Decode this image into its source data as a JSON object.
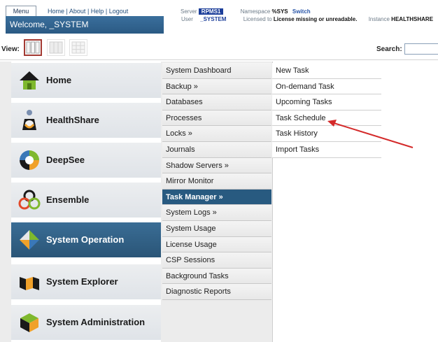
{
  "header": {
    "menu_tab": "Menu",
    "links": [
      "Home",
      "About",
      "Help",
      "Logout"
    ],
    "link_separator": "|",
    "welcome": "Welcome, _SYSTEM",
    "server_label": "Server",
    "server_value": "RPMS1",
    "user_label": "User",
    "user_value": "_SYSTEM",
    "namespace_label": "Namespace",
    "namespace_value": "%SYS",
    "switch_label": "Switch",
    "licensed_label": "Licensed to",
    "licensed_value": "License missing or unreadable.",
    "instance_label": "Instance",
    "instance_value": "HEALTHSHARE"
  },
  "viewbar": {
    "view_label": "View:",
    "search_label": "Search:",
    "search_value": ""
  },
  "categories": [
    {
      "label": "Home",
      "icon": "home-icon",
      "active": false
    },
    {
      "label": "HealthShare",
      "icon": "healthshare-icon",
      "active": false
    },
    {
      "label": "DeepSee",
      "icon": "deepsee-icon",
      "active": false
    },
    {
      "label": "Ensemble",
      "icon": "ensemble-icon",
      "active": false
    },
    {
      "label": "System Operation",
      "icon": "system-operation-icon",
      "active": true
    },
    {
      "label": "System Explorer",
      "icon": "system-explorer-icon",
      "active": false
    },
    {
      "label": "System Administration",
      "icon": "system-administration-icon",
      "active": false
    }
  ],
  "submenu": [
    "System Dashboard",
    "Backup »",
    "Databases",
    "Processes",
    "Locks »",
    "Journals",
    "Shadow Servers »",
    "Mirror Monitor",
    "Task Manager »",
    "System Logs »",
    "System Usage",
    "License Usage",
    "CSP Sessions",
    "Background Tasks",
    "Diagnostic Reports"
  ],
  "submenu_active": "Task Manager »",
  "task_manager_items": [
    "New Task",
    "On-demand Task",
    "Upcoming Tasks",
    "Task Schedule",
    "Task History",
    "Import Tasks"
  ],
  "colors": {
    "accent": "#285a80",
    "annotation_arrow": "#d42a2a",
    "server_badge": "#1d3f9a"
  }
}
